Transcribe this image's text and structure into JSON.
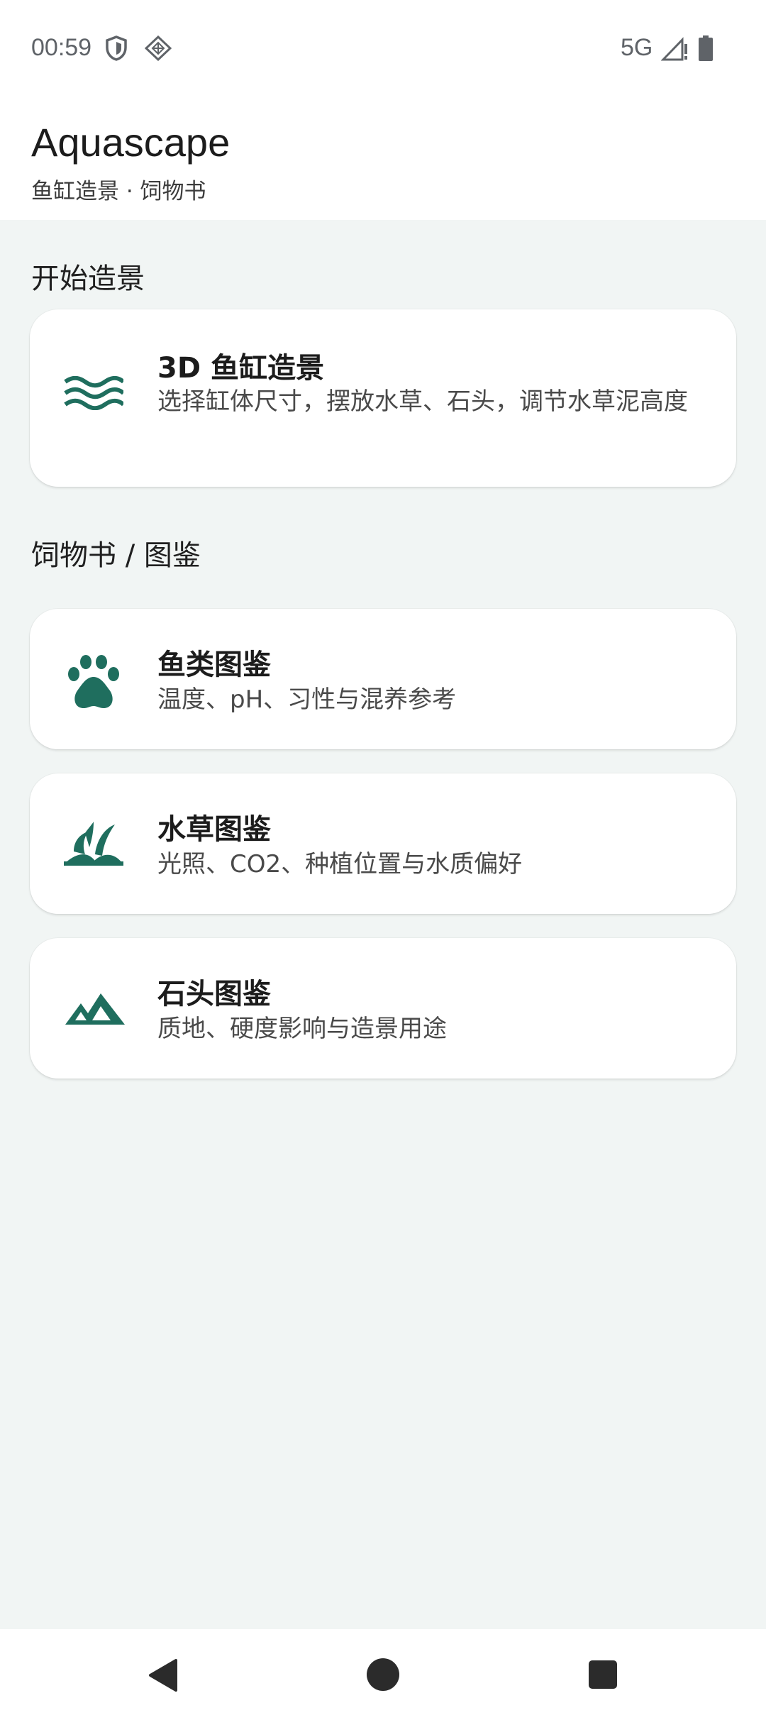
{
  "status_bar": {
    "time": "00:59",
    "network": "5G",
    "icons": [
      "shield-icon",
      "vpn-diamond-icon",
      "signal-icon",
      "battery-icon"
    ]
  },
  "header": {
    "title": "Aquascape",
    "subtitle": "鱼缸造景 · 饲物书"
  },
  "sections": {
    "start": "开始造景",
    "guides": "饲物书 / 图鉴"
  },
  "cards": {
    "tank": {
      "title": "3D 鱼缸造景",
      "desc": "选择缸体尺寸，摆放水草、石头，调节水草泥高度",
      "icon": "waves-icon"
    },
    "fish": {
      "title": "鱼类图鉴",
      "desc": "温度、pH、习性与混养参考",
      "icon": "paw-icon"
    },
    "plant": {
      "title": "水草图鉴",
      "desc": "光照、CO2、种植位置与水质偏好",
      "icon": "grass-icon"
    },
    "stone": {
      "title": "石头图鉴",
      "desc": "质地、硬度影响与造景用途",
      "icon": "mountain-icon"
    }
  },
  "colors": {
    "accent": "#1f6e5e",
    "background": "#f1f5f4",
    "card": "#ffffff"
  },
  "nav": [
    "back-icon",
    "home-icon",
    "recents-icon"
  ]
}
